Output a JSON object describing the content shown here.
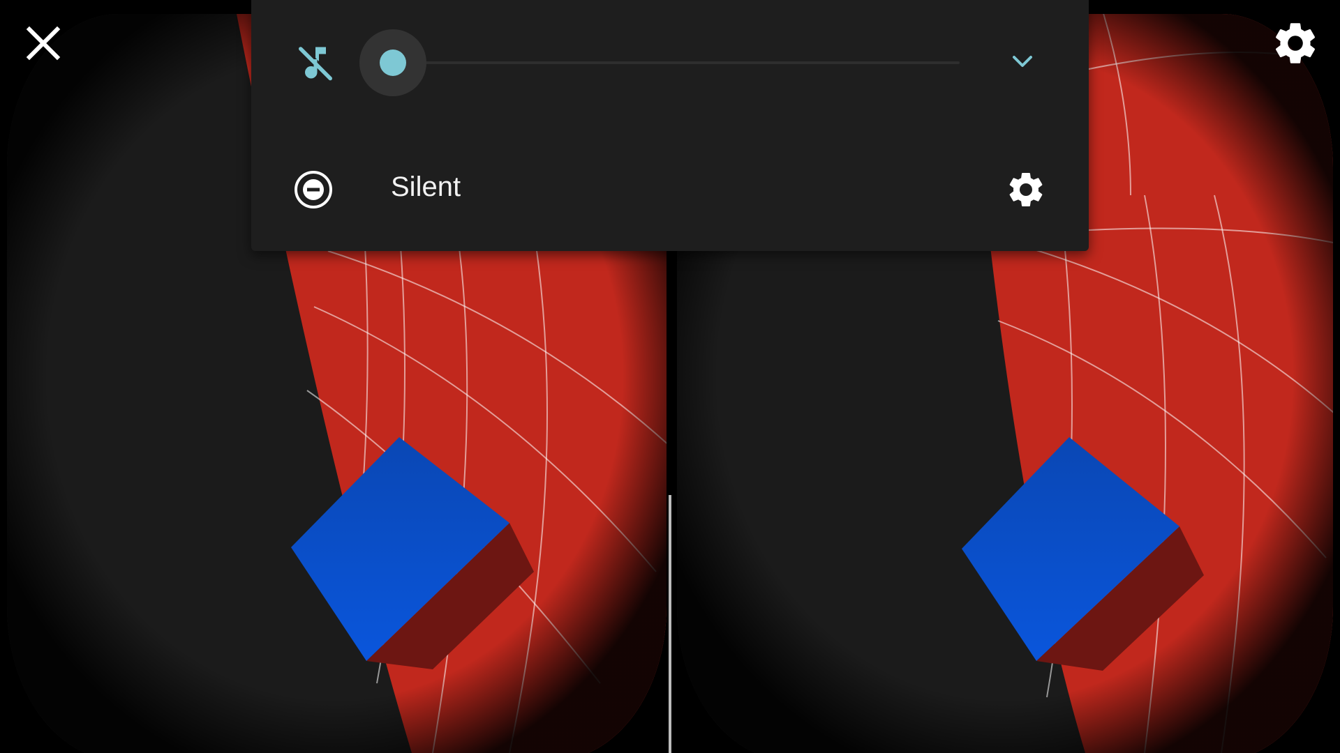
{
  "volume_panel": {
    "mode_label": "Silent",
    "volume_level": 0,
    "accent_color": "#7ec8d4",
    "icons": [
      "music-note-off-icon",
      "chevron-down-icon",
      "do-not-disturb-icon",
      "gear-icon"
    ]
  },
  "vr_view": {
    "icons": [
      "close-icon",
      "gear-icon"
    ],
    "colors": {
      "background": "#1b1b1b",
      "sphere": "#c1281d",
      "cube_face": "#0a4cc0",
      "cube_side": "#6d1612"
    }
  }
}
